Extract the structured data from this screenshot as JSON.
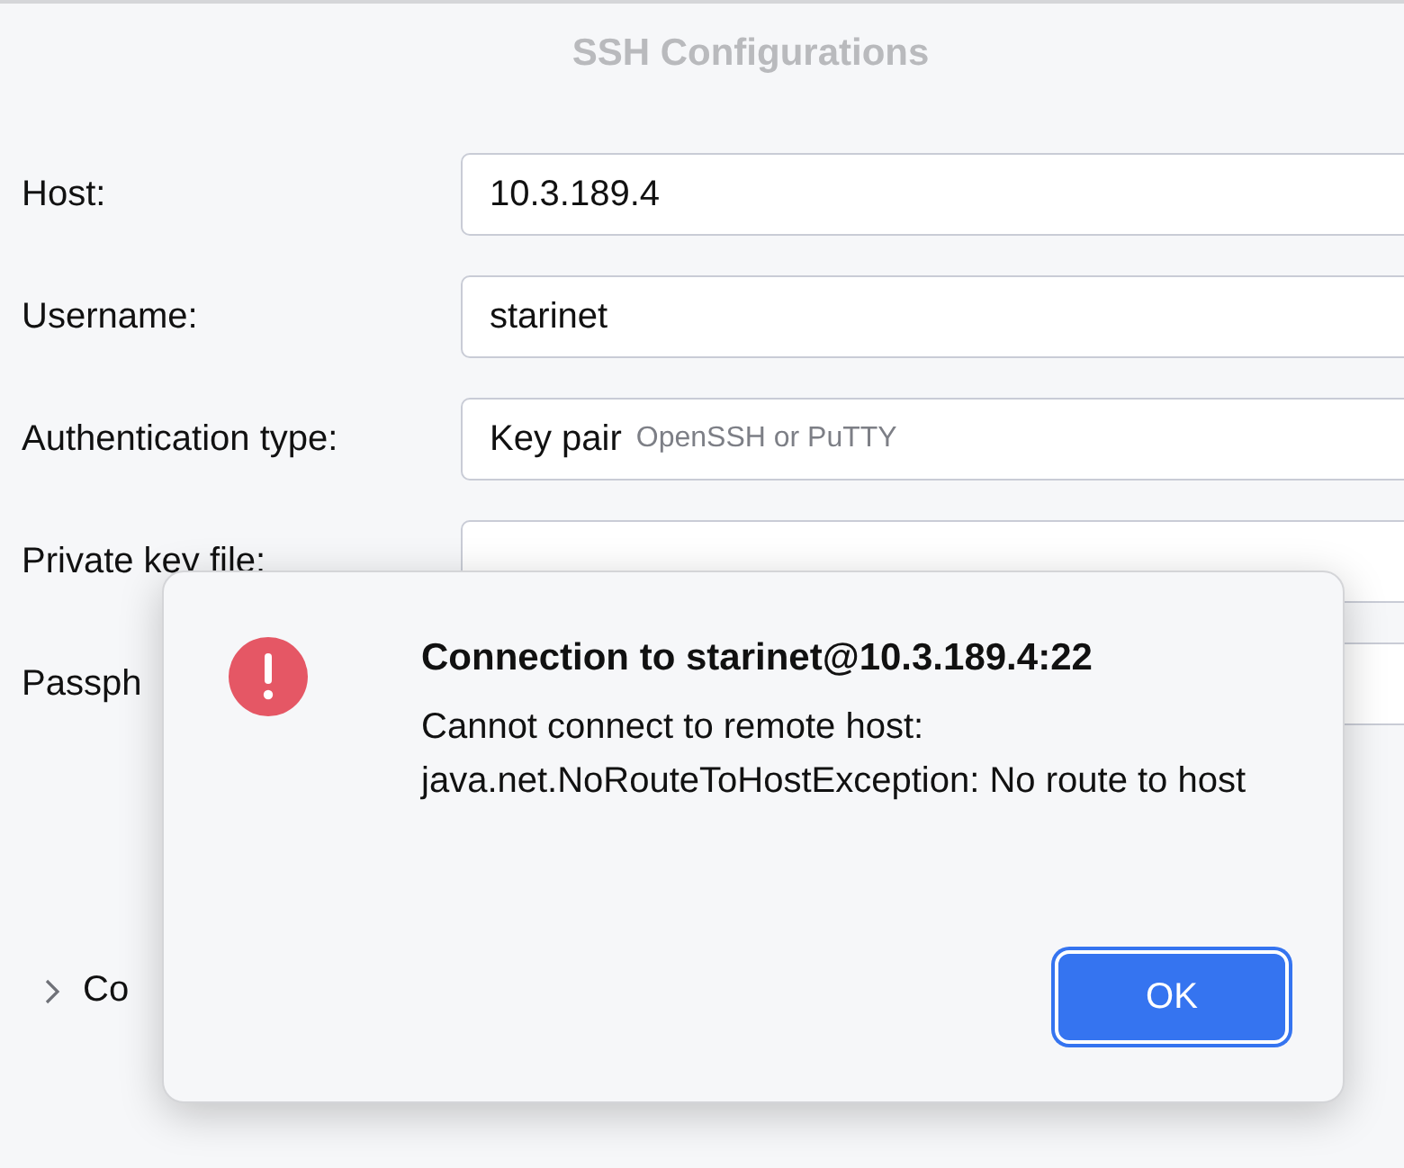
{
  "window": {
    "title": "SSH Configurations"
  },
  "fields": [
    {
      "kind": "text",
      "label": "Host:",
      "value": "10.3.189.4"
    },
    {
      "kind": "text",
      "label": "Username:",
      "value": "starinet"
    },
    {
      "kind": "select",
      "label": "Authentication type:",
      "value": "Key pair",
      "hint": "OpenSSH or PuTTY"
    },
    {
      "kind": "text",
      "label": "Private key file:"
    },
    {
      "kind": "password",
      "label": "Passph"
    }
  ],
  "section": {
    "label": "Co",
    "expanded": false
  },
  "dialog": {
    "title": "Connection to starinet@10.3.189.4:22",
    "message": "Cannot connect to remote host: java.net.NoRouteToHostException: No route to host",
    "buttons": [
      {
        "label": "OK",
        "default": true
      }
    ]
  }
}
